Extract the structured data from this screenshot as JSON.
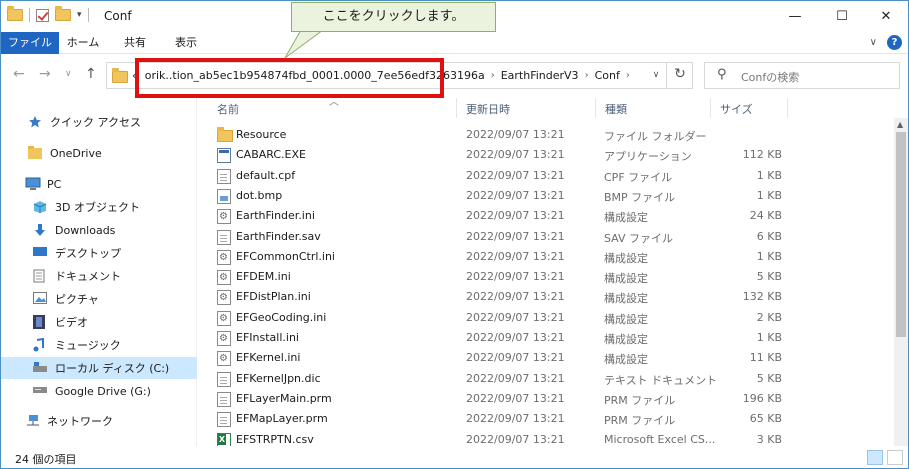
{
  "window": {
    "title": "Conf",
    "controls": {
      "minimize": "—",
      "maximize": "☐",
      "close": "✕"
    }
  },
  "callout": {
    "text": "ここをクリックします。"
  },
  "ribbon": {
    "tabs": [
      "ファイル",
      "ホーム",
      "共有",
      "表示"
    ],
    "expand": "∨",
    "help": "?"
  },
  "nav": {
    "back": "←",
    "forward": "→",
    "recent": "∨",
    "up": "↑",
    "path_prefix": "«",
    "path": [
      "orik..tion_ab5ec1b954874fbd_0001.0000_7ee56edf3263196a",
      "EarthFinderV3",
      "Conf"
    ],
    "path_sep": "›",
    "dropdown": "∨",
    "refresh": "↻",
    "search_placeholder": "Confの検索"
  },
  "sidebar": {
    "items": [
      {
        "label": "クイック アクセス",
        "icon": "star-icon"
      },
      {
        "label": "OneDrive",
        "icon": "folder-icon"
      },
      {
        "label": "PC",
        "icon": "pc-icon"
      },
      {
        "label": "3D オブジェクト",
        "icon": "cube-icon"
      },
      {
        "label": "Downloads",
        "icon": "download-icon"
      },
      {
        "label": "デスクトップ",
        "icon": "desktop-icon"
      },
      {
        "label": "ドキュメント",
        "icon": "document-icon"
      },
      {
        "label": "ピクチャ",
        "icon": "picture-icon"
      },
      {
        "label": "ビデオ",
        "icon": "video-icon"
      },
      {
        "label": "ミュージック",
        "icon": "music-icon"
      },
      {
        "label": "ローカル ディスク (C:)",
        "icon": "drive-icon",
        "selected": true
      },
      {
        "label": "Google Drive (G:)",
        "icon": "drive-icon"
      },
      {
        "label": "ネットワーク",
        "icon": "network-icon"
      }
    ]
  },
  "columns": {
    "name": "名前",
    "date": "更新日時",
    "type": "種類",
    "size": "サイズ"
  },
  "files": [
    {
      "name": "Resource",
      "date": "2022/09/07 13:21",
      "type": "ファイル フォルダー",
      "size": "",
      "icon": "folder"
    },
    {
      "name": "CABARC.EXE",
      "date": "2022/09/07 13:21",
      "type": "アプリケーション",
      "size": "112 KB",
      "icon": "exe"
    },
    {
      "name": "default.cpf",
      "date": "2022/09/07 13:21",
      "type": "CPF ファイル",
      "size": "1 KB",
      "icon": "doc"
    },
    {
      "name": "dot.bmp",
      "date": "2022/09/07 13:21",
      "type": "BMP ファイル",
      "size": "1 KB",
      "icon": "img"
    },
    {
      "name": "EarthFinder.ini",
      "date": "2022/09/07 13:21",
      "type": "構成設定",
      "size": "24 KB",
      "icon": "ini"
    },
    {
      "name": "EarthFinder.sav",
      "date": "2022/09/07 13:21",
      "type": "SAV ファイル",
      "size": "6 KB",
      "icon": "doc"
    },
    {
      "name": "EFCommonCtrl.ini",
      "date": "2022/09/07 13:21",
      "type": "構成設定",
      "size": "1 KB",
      "icon": "ini"
    },
    {
      "name": "EFDEM.ini",
      "date": "2022/09/07 13:21",
      "type": "構成設定",
      "size": "5 KB",
      "icon": "ini"
    },
    {
      "name": "EFDistPlan.ini",
      "date": "2022/09/07 13:21",
      "type": "構成設定",
      "size": "132 KB",
      "icon": "ini"
    },
    {
      "name": "EFGeoCoding.ini",
      "date": "2022/09/07 13:21",
      "type": "構成設定",
      "size": "2 KB",
      "icon": "ini"
    },
    {
      "name": "EFInstall.ini",
      "date": "2022/09/07 13:21",
      "type": "構成設定",
      "size": "1 KB",
      "icon": "ini"
    },
    {
      "name": "EFKernel.ini",
      "date": "2022/09/07 13:21",
      "type": "構成設定",
      "size": "11 KB",
      "icon": "ini"
    },
    {
      "name": "EFKernelJpn.dic",
      "date": "2022/09/07 13:21",
      "type": "テキスト ドキュメント",
      "size": "5 KB",
      "icon": "doc"
    },
    {
      "name": "EFLayerMain.prm",
      "date": "2022/09/07 13:21",
      "type": "PRM ファイル",
      "size": "196 KB",
      "icon": "doc"
    },
    {
      "name": "EFMapLayer.prm",
      "date": "2022/09/07 13:21",
      "type": "PRM ファイル",
      "size": "65 KB",
      "icon": "doc"
    },
    {
      "name": "EFSTRPTN.csv",
      "date": "2022/09/07 13:21",
      "type": "Microsoft Excel CS...",
      "size": "3 KB",
      "icon": "xls"
    }
  ],
  "status": {
    "count": "24 個の項目"
  },
  "colors": {
    "accent": "#1e66c2",
    "highlight": "#e01010",
    "callout_bg": "#ebf2de",
    "selected": "#cce8ff"
  }
}
